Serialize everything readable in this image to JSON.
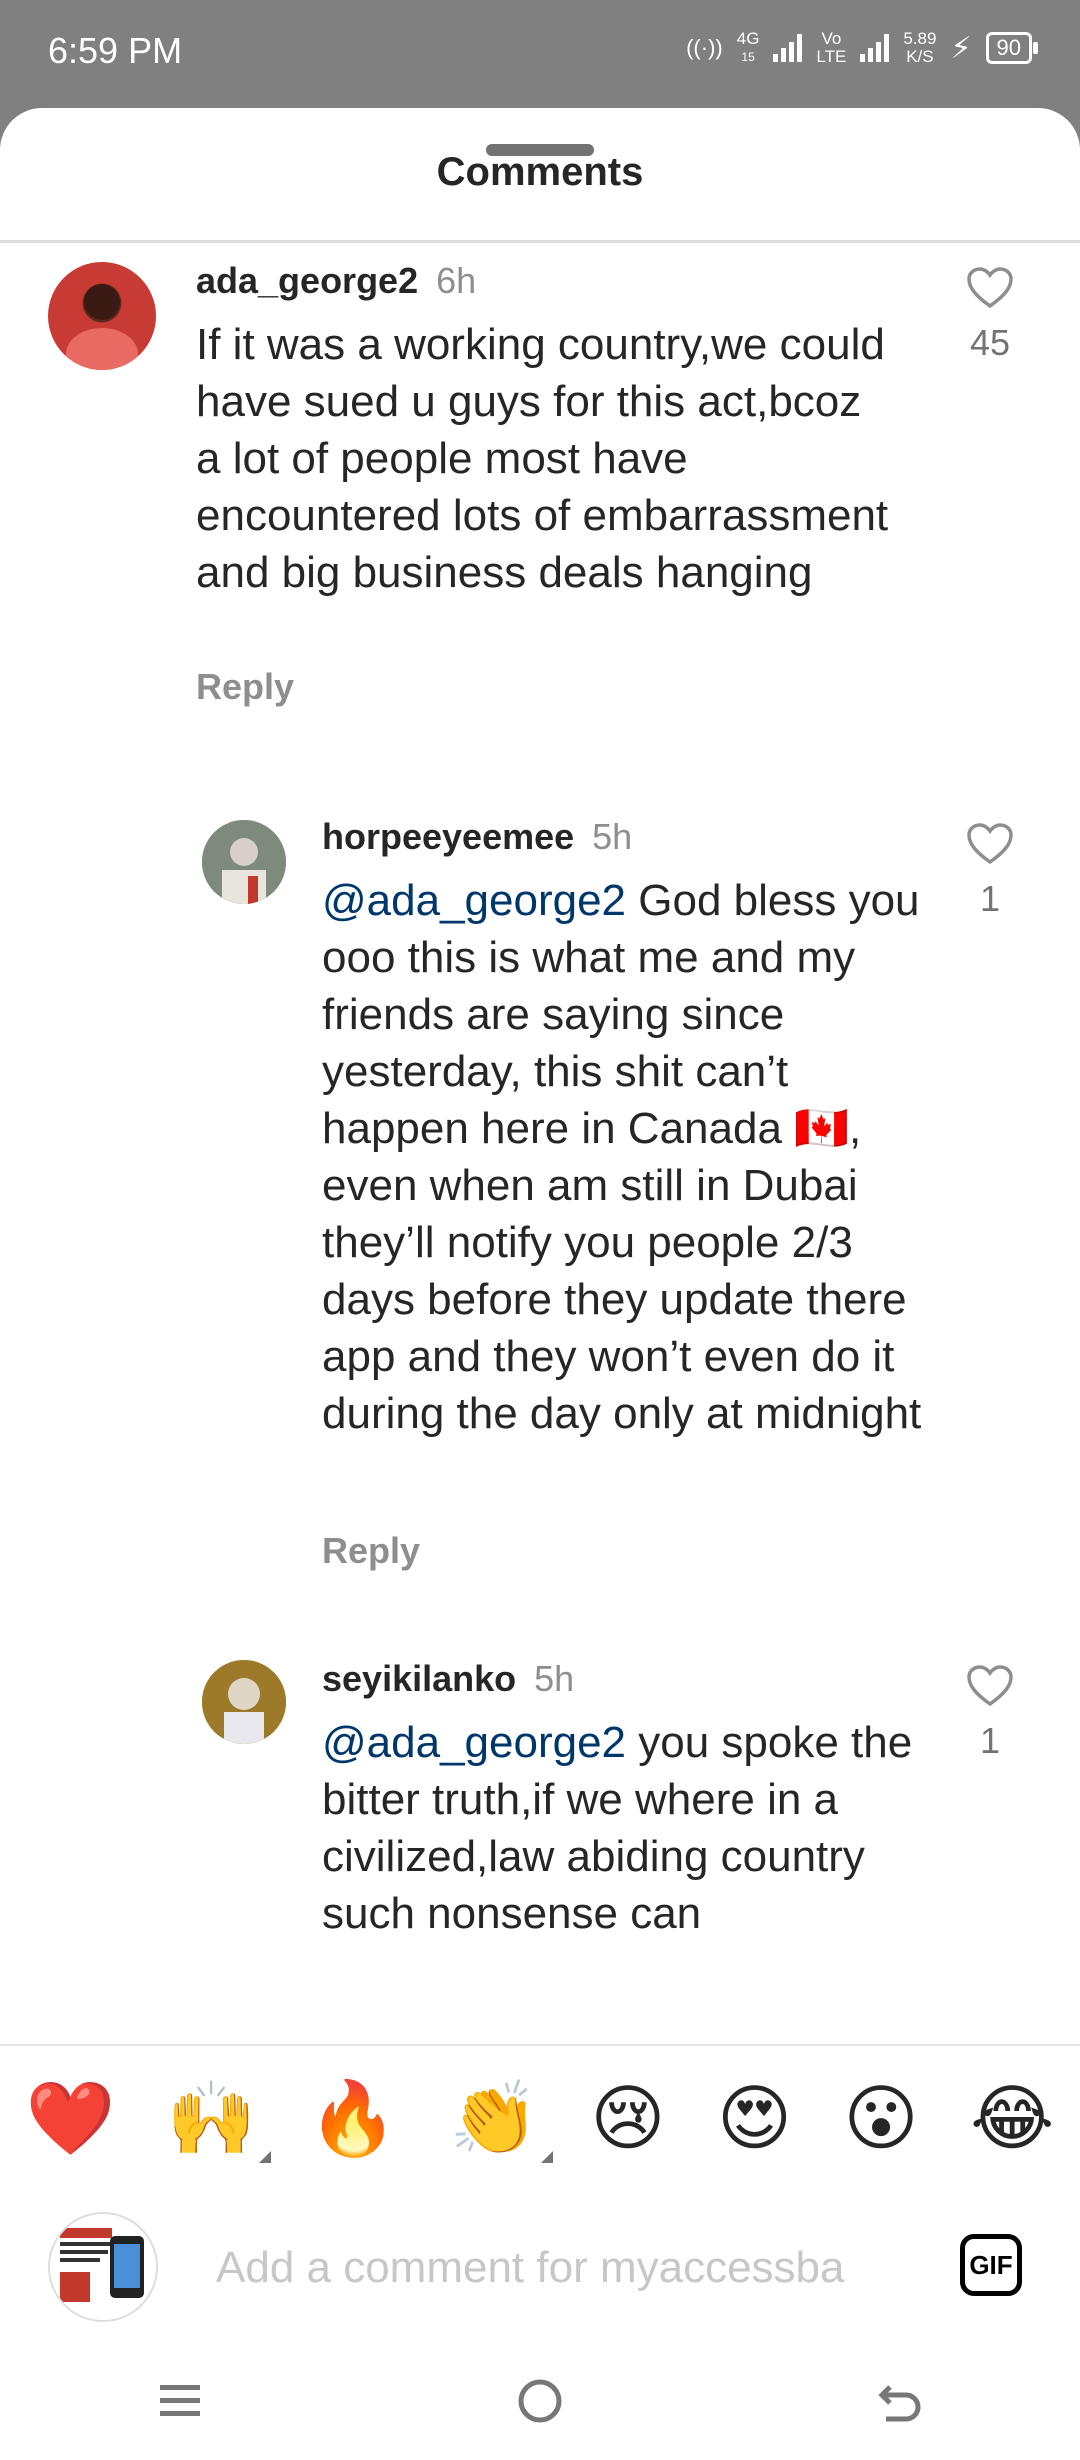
{
  "status_bar": {
    "time": "6:59 PM",
    "hotspot": "((·))",
    "net1": "4G",
    "net1_sub": "15",
    "net2_top": "Vo",
    "net2_bottom": "LTE",
    "speed_value": "5.89",
    "speed_unit": "K/S",
    "battery": "90"
  },
  "sheet": {
    "title": "Comments"
  },
  "comments": [
    {
      "username": "ada_george2",
      "time": "6h",
      "text": "If it was a working country,we could have sued u guys for this act,bcoz a lot of people most have encountered lots of embarrassment and big business deals hanging",
      "reply_label": "Reply",
      "likes": "45"
    },
    {
      "username": "horpeeyeemee",
      "time": "5h",
      "mention": "@ada_george2",
      "text": " God bless you ooo this is what me and my friends are saying since yesterday, this shit can’t happen here in Canada 🇨🇦, even when am still in Dubai they’ll notify you people 2/3 days before they update there app and they won’t even do it during the day only at midnight",
      "reply_label": "Reply",
      "likes": "1"
    },
    {
      "username": "seyikilanko",
      "time": "5h",
      "mention": "@ada_george2",
      "text": " you spoke the bitter truth,if we where in a civilized,law abiding country such nonsense can",
      "likes": "1"
    }
  ],
  "emoji_bar": [
    "❤️",
    "🙌",
    "🔥",
    "👏",
    "😢",
    "😍",
    "😮",
    "😂"
  ],
  "composer": {
    "placeholder": "Add a comment for myaccessba",
    "gif_label": "GIF"
  },
  "colors": {
    "mention": "#00376b",
    "meta_gray": "#8e8e8e",
    "status_bar_bg": "#808080"
  }
}
